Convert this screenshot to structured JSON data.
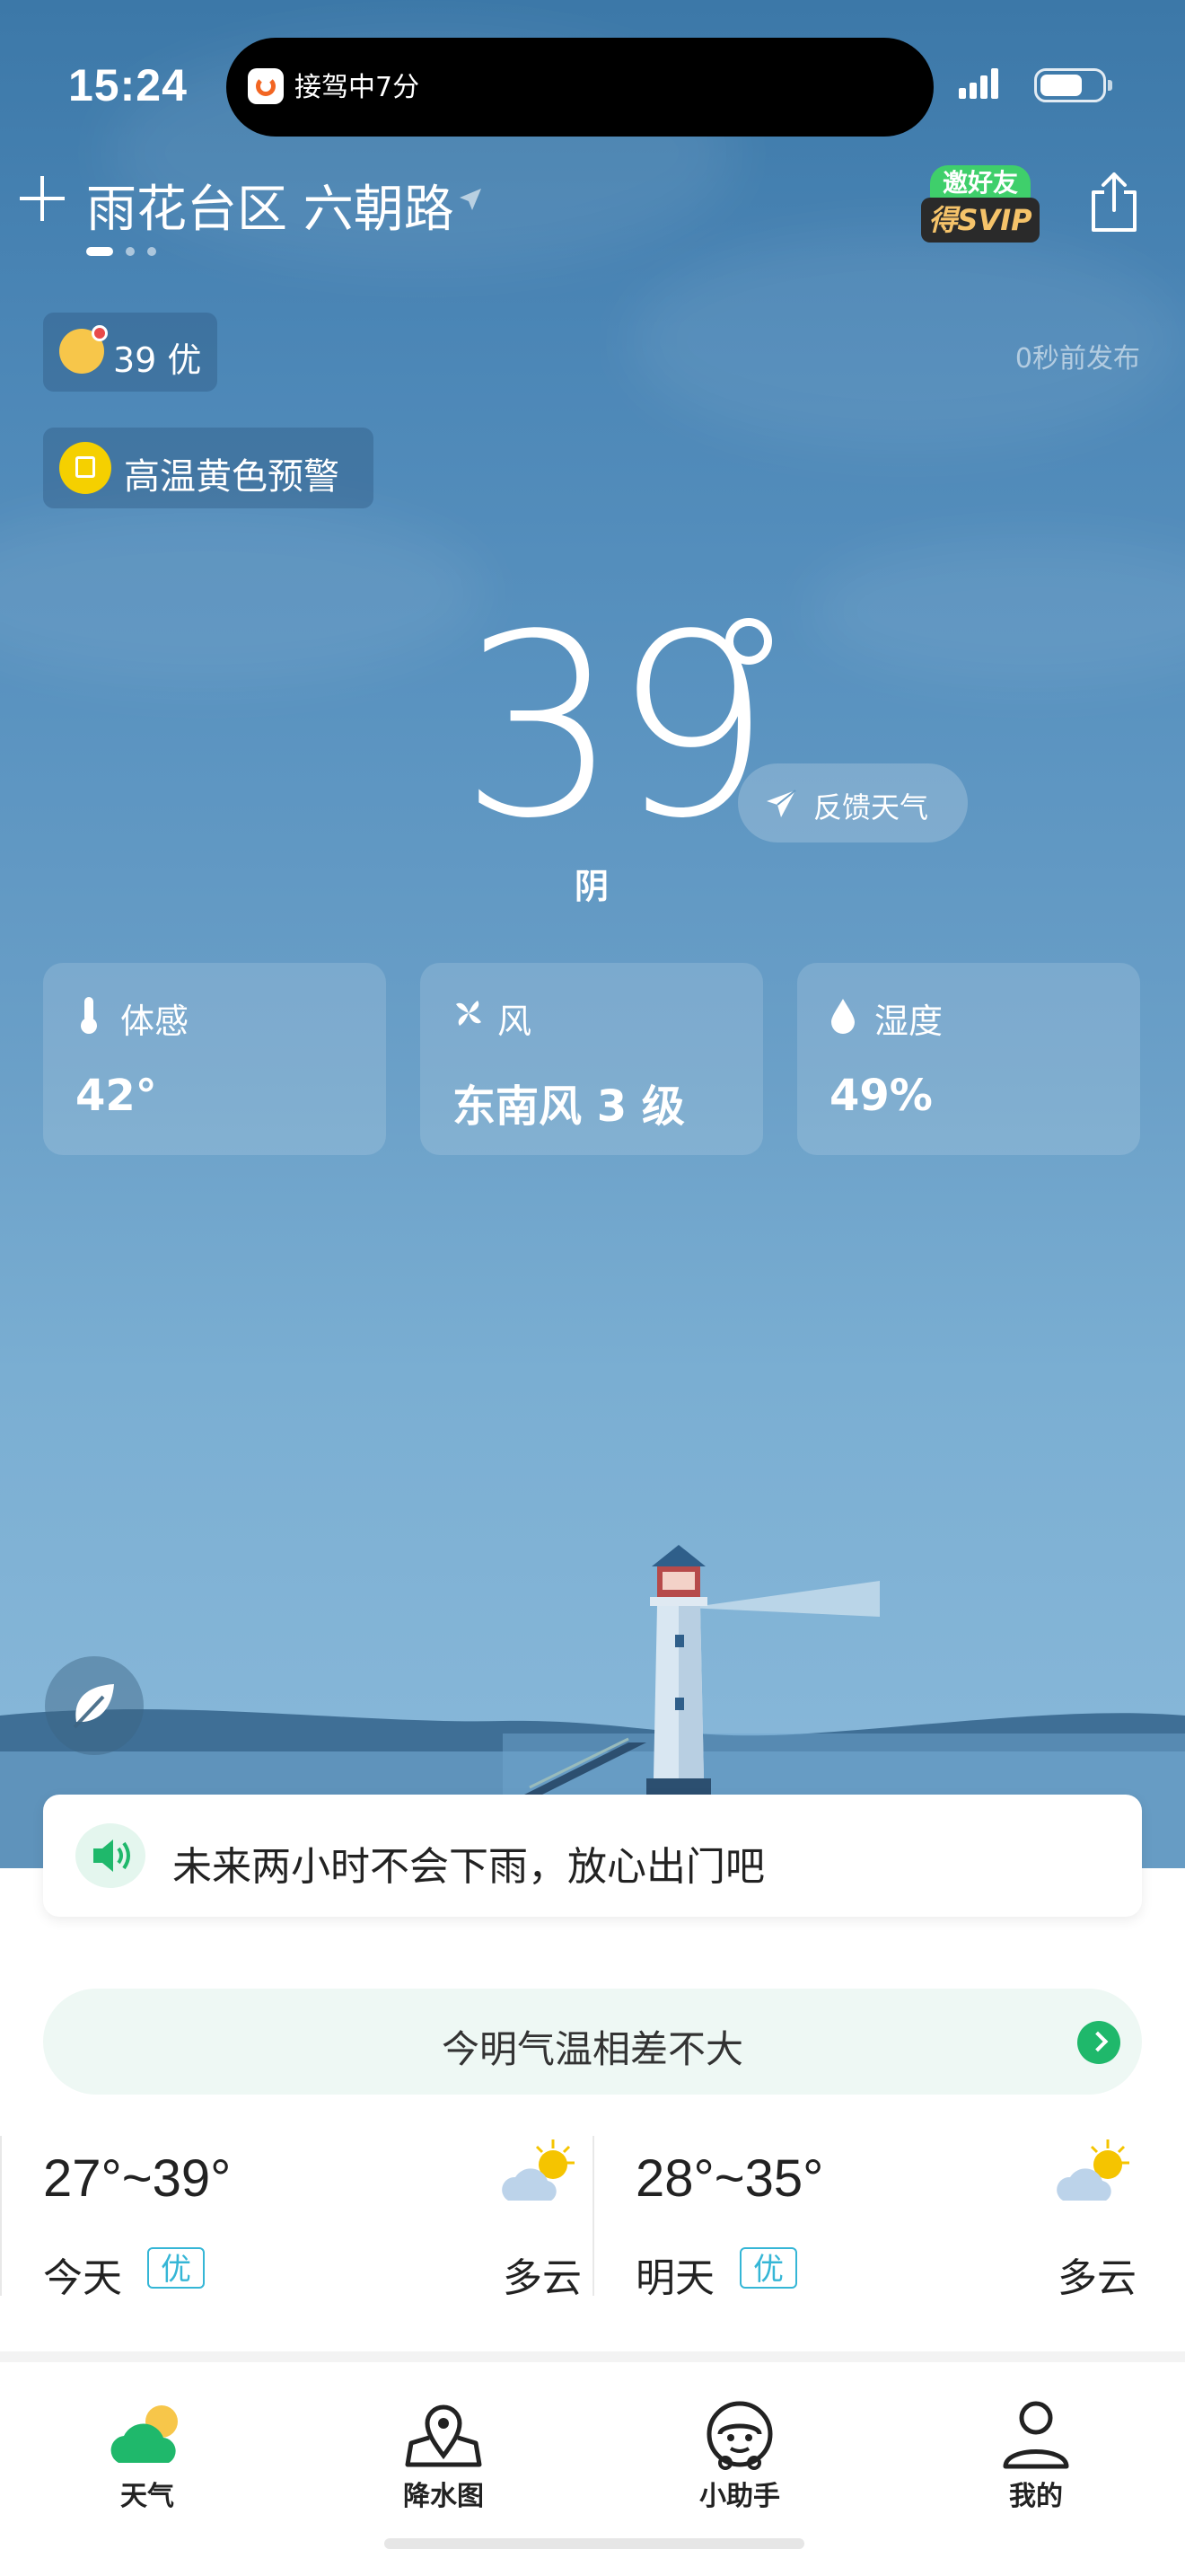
{
  "status_bar": {
    "time": "15:24",
    "island_text": "接驾中7分"
  },
  "header": {
    "location": "雨花台区 六朝路",
    "svip_top": "邀好友",
    "svip_bottom": "得SVIP"
  },
  "aqi": {
    "text": "39 优"
  },
  "publish_time": "0秒前发布",
  "warning": {
    "text": "高温黄色预警"
  },
  "current": {
    "temperature": "39",
    "condition": "阴",
    "feedback_label": "反馈天气"
  },
  "cards": [
    {
      "label": "体感",
      "value": "42°"
    },
    {
      "label": "风",
      "value": "东南风 3 级"
    },
    {
      "label": "湿度",
      "value": "49%"
    }
  ],
  "rain_notice": "未来两小时不会下雨，放心出门吧",
  "compare_text": "今明气温相差不大",
  "days": [
    {
      "range": "27°~39°",
      "name": "今天",
      "badge": "优",
      "condition": "多云"
    },
    {
      "range": "28°~35°",
      "name": "明天",
      "badge": "优",
      "condition": "多云"
    }
  ],
  "tabs": [
    {
      "label": "天气",
      "icon": "weather-icon"
    },
    {
      "label": "降水图",
      "icon": "map-pin-icon"
    },
    {
      "label": "小助手",
      "icon": "assistant-icon"
    },
    {
      "label": "我的",
      "icon": "profile-icon"
    }
  ],
  "colors": {
    "accent": "#1fb86b",
    "badge": "#35b6d6",
    "warning": "#f5d000"
  }
}
